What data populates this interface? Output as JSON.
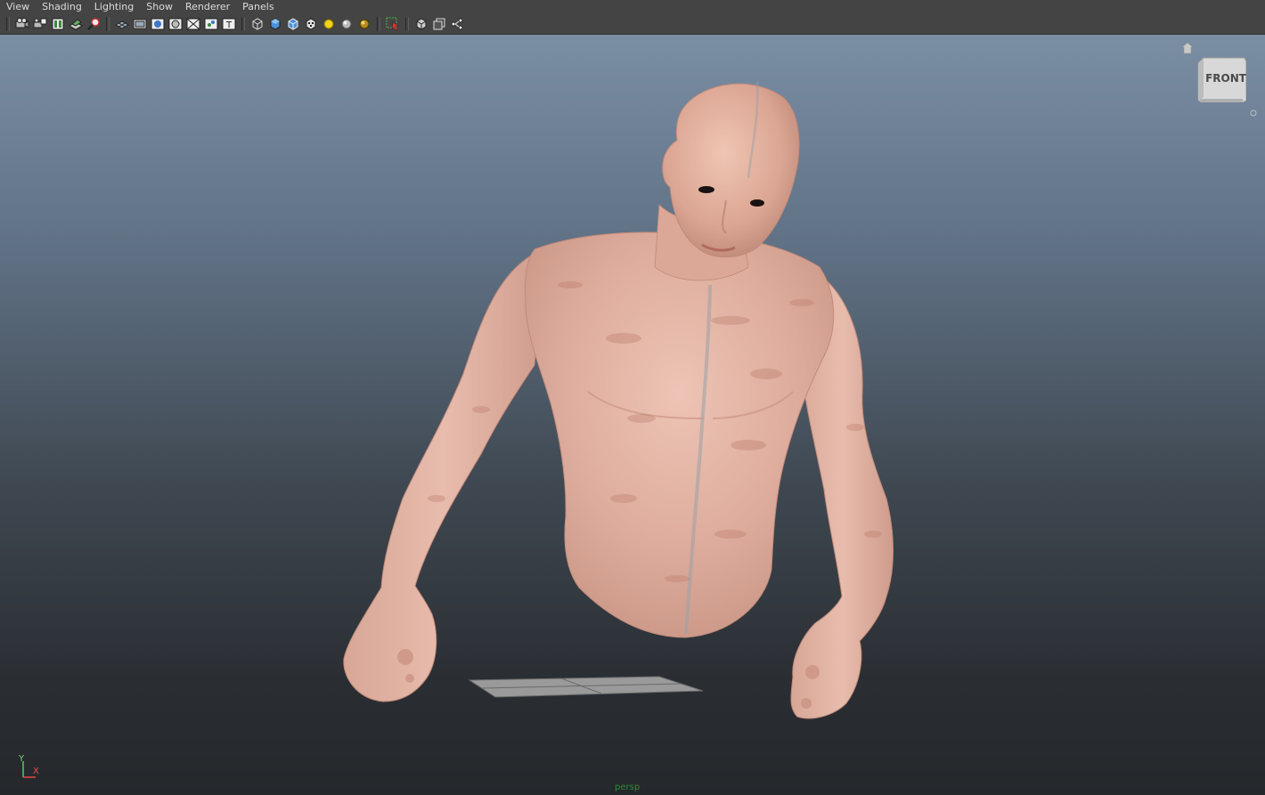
{
  "menubar": {
    "items": [
      "View",
      "Shading",
      "Lighting",
      "Show",
      "Renderer",
      "Panels"
    ]
  },
  "toolbar": {
    "groups": [
      [
        "select-camera-icon",
        "camera-attributes-icon",
        "bookmarks-icon",
        "image-plane-icon",
        "2d-pan-zoom-icon"
      ],
      [
        "grid-icon",
        "film-gate-icon",
        "resolution-gate-icon",
        "gate-mask-icon",
        "field-chart-icon",
        "safe-action-icon",
        "safe-title-icon"
      ],
      [
        "wireframe-icon",
        "smooth-shade-icon",
        "wireframe-on-shaded-icon",
        "textured-icon",
        "use-all-lights-icon",
        "shadows-icon",
        "ambient-occlusion-icon"
      ],
      [
        "isolate-select-icon"
      ],
      [
        "xray-icon",
        "xray-active-icon",
        "xray-joints-icon"
      ]
    ]
  },
  "viewport": {
    "viewcube_label": "FRONT",
    "axis_y": "Y",
    "axis_x": "X",
    "camera_name": "persp"
  },
  "colors": {
    "panel": "#444444",
    "menu_text": "#dcdcdc",
    "viewport_top": "#7a8ea4",
    "viewport_bottom": "#25282b",
    "skin": "#e2b4a4",
    "camera_label": "#2f8a3a"
  }
}
